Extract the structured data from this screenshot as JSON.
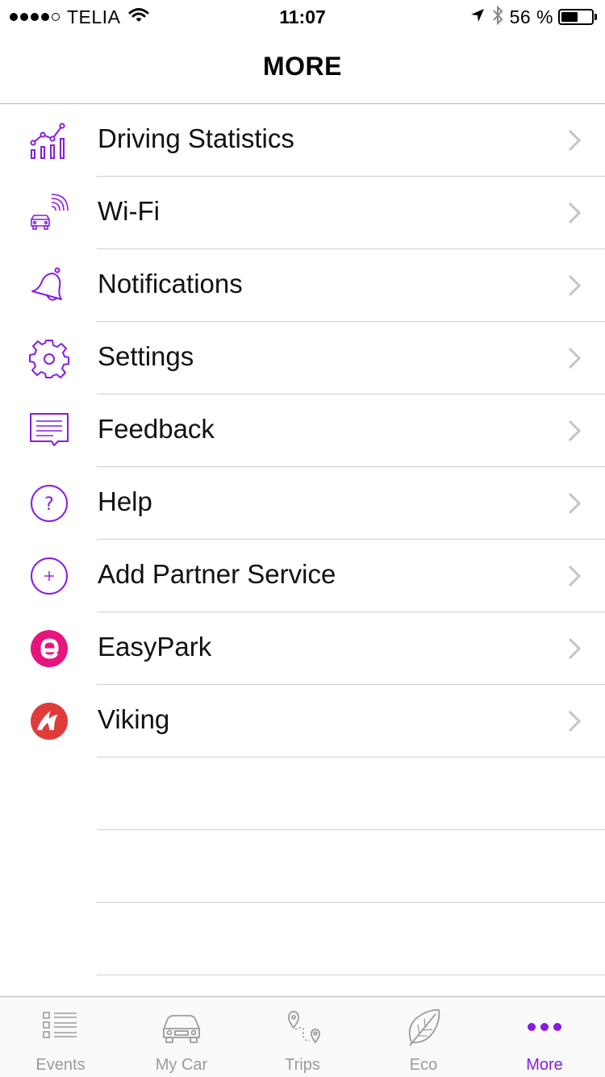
{
  "status_bar": {
    "carrier": "TELIA",
    "time": "11:07",
    "battery_percent": "56 %",
    "battery_level": 0.56,
    "signal_bars": 4
  },
  "nav": {
    "title": "MORE"
  },
  "menu": {
    "items": [
      {
        "label": "Driving Statistics",
        "icon": "chart-icon"
      },
      {
        "label": "Wi-Fi",
        "icon": "car-wifi-icon"
      },
      {
        "label": "Notifications",
        "icon": "bell-icon"
      },
      {
        "label": "Settings",
        "icon": "gear-icon"
      },
      {
        "label": "Feedback",
        "icon": "message-icon"
      },
      {
        "label": "Help",
        "icon": "question-icon"
      },
      {
        "label": "Add Partner Service",
        "icon": "plus-circle-icon"
      },
      {
        "label": "EasyPark",
        "icon": "easypark-logo"
      },
      {
        "label": "Viking",
        "icon": "viking-logo"
      }
    ]
  },
  "tabs": [
    {
      "label": "Events",
      "icon": "list-icon",
      "active": false
    },
    {
      "label": "My Car",
      "icon": "car-icon",
      "active": false
    },
    {
      "label": "Trips",
      "icon": "route-icon",
      "active": false
    },
    {
      "label": "Eco",
      "icon": "leaf-icon",
      "active": false
    },
    {
      "label": "More",
      "icon": "more-dots-icon",
      "active": true
    }
  ],
  "colors": {
    "accent": "#8a1be0",
    "easypark": "#e6157e",
    "viking": "#e03b3b",
    "inactive": "#9b9b9b"
  }
}
